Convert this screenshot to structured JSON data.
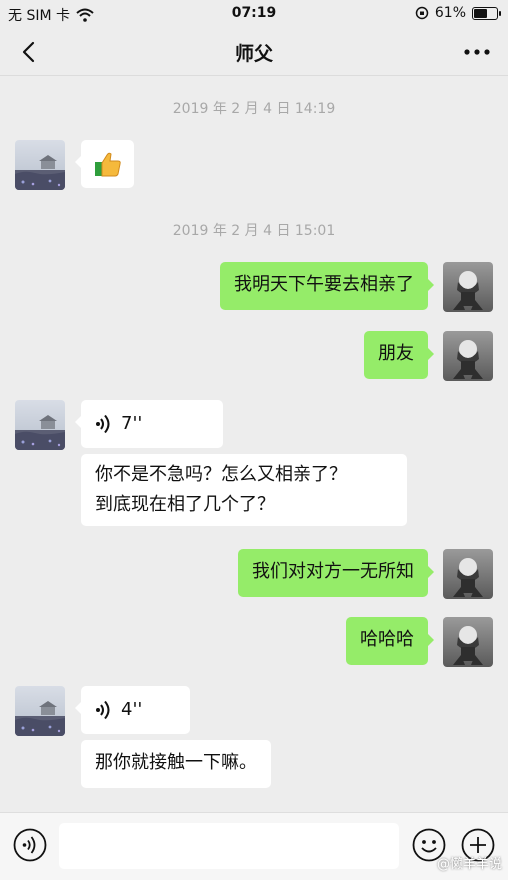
{
  "status_bar": {
    "carrier": "无 SIM 卡",
    "time": "07:19",
    "battery_percent": "61%",
    "battery_level": 0.61
  },
  "nav": {
    "title": "师父"
  },
  "timestamps": [
    "2019 年 2 月 4 日 14:19",
    "2019 年 2 月 4 日 15:01"
  ],
  "messages": {
    "m1": {
      "sender": "contact",
      "type": "emoji",
      "icon": "thumbs-up-icon"
    },
    "m2": {
      "sender": "me",
      "type": "text",
      "text": "我明天下午要去相亲了"
    },
    "m3": {
      "sender": "me",
      "type": "text",
      "text": "朋友"
    },
    "m4": {
      "sender": "contact",
      "type": "voice",
      "duration": "7''"
    },
    "m5": {
      "sender": "contact",
      "type": "text",
      "line1": "你不是不急吗？怎么又相亲了？",
      "line2": "到底现在相了几个了？"
    },
    "m6": {
      "sender": "me",
      "type": "text",
      "text": "我们对对方一无所知"
    },
    "m7": {
      "sender": "me",
      "type": "text",
      "text": "哈哈哈"
    },
    "m8": {
      "sender": "contact",
      "type": "voice",
      "duration": "4''"
    },
    "m9": {
      "sender": "contact",
      "type": "text",
      "text": "那你就接触一下嘛。"
    }
  },
  "input_bar": {
    "placeholder": ""
  },
  "watermark": "@懒羊羊说"
}
